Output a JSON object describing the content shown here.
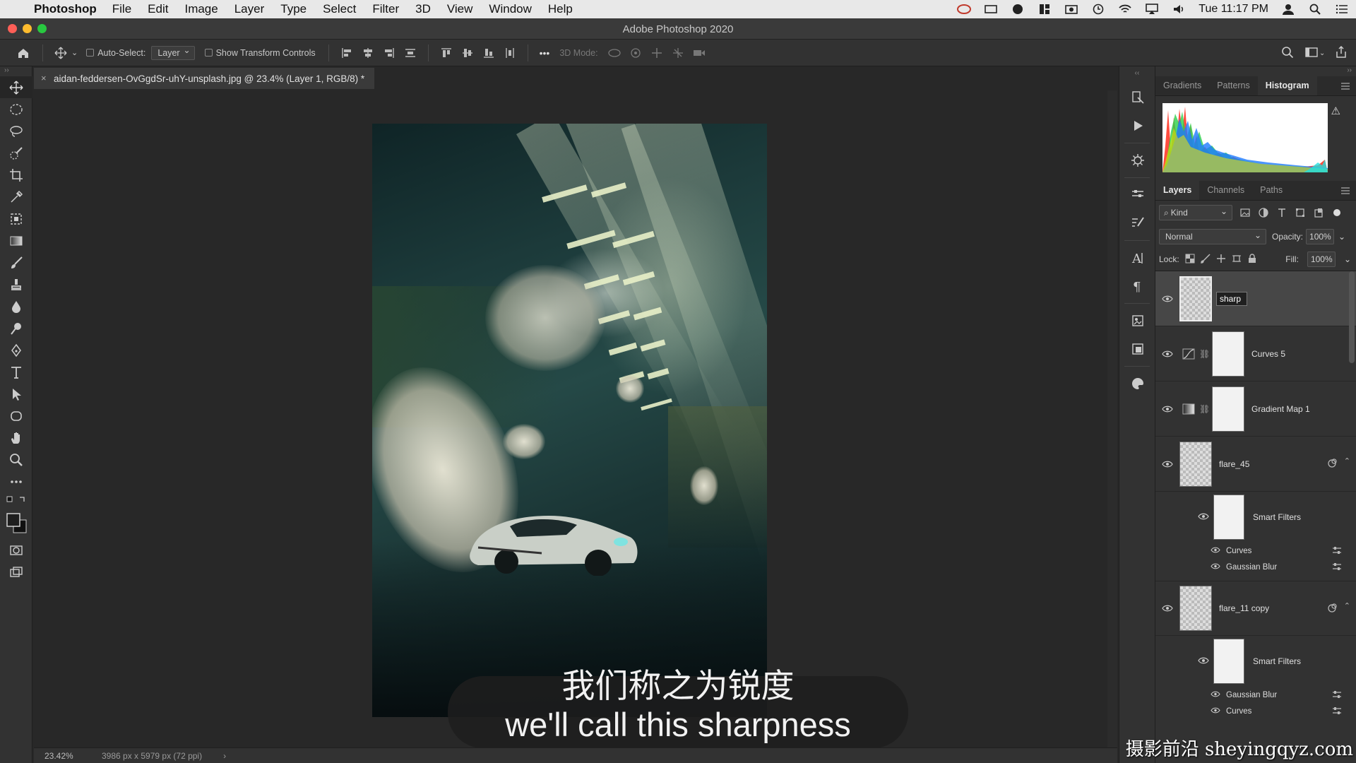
{
  "menubar": {
    "app_name": "Photoshop",
    "items": [
      "File",
      "Edit",
      "Image",
      "Layer",
      "Type",
      "Select",
      "Filter",
      "3D",
      "View",
      "Window",
      "Help"
    ],
    "clock": "Tue 11:17 PM"
  },
  "window": {
    "title": "Adobe Photoshop 2020"
  },
  "options": {
    "auto_select_label": "Auto-Select:",
    "auto_select_value": "Layer",
    "show_transform_label": "Show Transform Controls",
    "mode_3d_label": "3D Mode:",
    "more_label": "•••"
  },
  "document": {
    "tab_title": "aidan-feddersen-OvGgdSr-uhY-unsplash.jpg @ 23.4% (Layer 1, RGB/8) *",
    "zoom": "23.42%",
    "info": "3986 px x 5979 px (72 ppi)"
  },
  "subtitles": {
    "chinese": "我们称之为锐度",
    "english": "we'll call this sharpness"
  },
  "panels": {
    "top_tabs": [
      "Gradients",
      "Patterns",
      "Histogram"
    ],
    "top_active": "Histogram",
    "layer_tabs": [
      "Layers",
      "Channels",
      "Paths"
    ],
    "layer_active": "Layers",
    "kind_label": "Kind",
    "blend_mode": "Normal",
    "opacity_label": "Opacity:",
    "opacity_value": "100%",
    "lock_label": "Lock:",
    "fill_label": "Fill:",
    "fill_value": "100%"
  },
  "layers": {
    "editing_name": "sharp",
    "curves5": "Curves 5",
    "gradient_map": "Gradient Map 1",
    "flare45": "flare_45",
    "smart_filters_1": "Smart Filters",
    "filter_curves_1": "Curves",
    "filter_blur_1": "Gaussian Blur",
    "flare11": "flare_11 copy",
    "smart_filters_2": "Smart Filters",
    "filter_blur_2": "Gaussian Blur",
    "filter_curves_2": "Curves"
  },
  "watermark": "摄影前沿 sheyingqyz.com",
  "colors": {
    "traffic_red": "#ff5f57",
    "traffic_yellow": "#febc2e",
    "traffic_green": "#28c840"
  }
}
